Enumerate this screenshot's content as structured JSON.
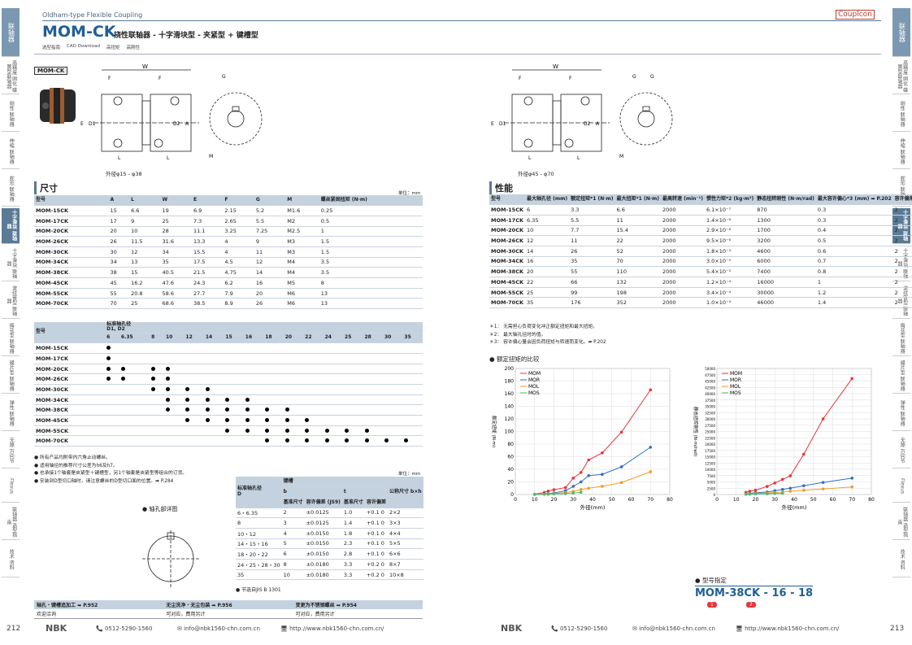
{
  "header": {
    "subtitle": "Oldham-type Flexible Coupling",
    "model": "MOM-CK",
    "desc": "挠性联轴器 - 十字滑块型 - 夹紧型 + 键槽型",
    "brand": "Couplcon",
    "links": [
      "选型指南",
      "CAD Download",
      "高扭矩",
      "高刚性"
    ]
  },
  "side_tabs_left": [
    "联轴器",
    "高精度 固化 碟簧型联轴器",
    "刚性 联轴器",
    "伸缩 联轴器",
    "蛇形 联轴器",
    "十字滑块 联轴器",
    "十字滑块 联轴器",
    "波纹管型 联轴器",
    "梅花型 联轴器",
    "膜片型 联轴器",
    "弹性 联轴器",
    "无隙 万向节",
    "Flexus",
    "联轴器 选型指南",
    "技术 资料"
  ],
  "side_tabs_right": [
    "联轴器",
    "高精度 固化 碟簧型联轴器",
    "刚性 联轴器",
    "伸缩 联轴器",
    "蛇形 联轴器",
    "十字滑块 联轴器",
    "十字滑块 联轴器",
    "波纹管型 联轴器",
    "梅花型 联轴器",
    "膜片型 联轴器",
    "弹性 联轴器",
    "无隙 万向节",
    "Flexus",
    "联轴器 选型指南",
    "技术 资料"
  ],
  "product_label": "MOM-CK",
  "diagram_left": {
    "caption": "外径φ15 - φ38",
    "labels": [
      "W",
      "F",
      "F",
      "G",
      "E",
      "D1",
      "D2",
      "A",
      "L",
      "L",
      "M"
    ]
  },
  "diagram_right": {
    "caption": "外径φ45 - φ70",
    "labels": [
      "W",
      "F",
      "F",
      "G",
      "G",
      "E",
      "D1",
      "D2",
      "A",
      "L",
      "L",
      "M"
    ]
  },
  "dimensions": {
    "title": "尺寸",
    "unit": "单位：mm",
    "headers": [
      "型号",
      "A",
      "L",
      "W",
      "E",
      "F",
      "G",
      "M",
      "螺丝紧固扭矩 (N·m)"
    ],
    "rows": [
      [
        "MOM-15CK",
        "15",
        "6.6",
        "19",
        "6.9",
        "2.15",
        "5.2",
        "M1.6",
        "0.25"
      ],
      [
        "MOM-17CK",
        "17",
        "9",
        "25",
        "7.3",
        "2.65",
        "5.5",
        "M2",
        "0.5"
      ],
      [
        "MOM-20CK",
        "20",
        "10",
        "28",
        "11.1",
        "3.25",
        "7.25",
        "M2.5",
        "1"
      ],
      [
        "MOM-26CK",
        "26",
        "11.5",
        "31.6",
        "13.3",
        "4",
        "9",
        "M3",
        "1.5"
      ],
      [
        "MOM-30CK",
        "30",
        "12",
        "34",
        "15.5",
        "4",
        "11",
        "M3",
        "1.5"
      ],
      [
        "MOM-34CK",
        "34",
        "13",
        "35",
        "17.5",
        "4.5",
        "12",
        "M4",
        "3.5"
      ],
      [
        "MOM-38CK",
        "38",
        "15",
        "40.5",
        "21.5",
        "4.75",
        "14",
        "M4",
        "3.5"
      ],
      [
        "MOM-45CK",
        "45",
        "16.2",
        "47.6",
        "24.3",
        "6.2",
        "16",
        "M5",
        "8"
      ],
      [
        "MOM-55CK",
        "55",
        "20.8",
        "58.6",
        "27.7",
        "7.9",
        "20",
        "M6",
        "13"
      ],
      [
        "MOM-70CK",
        "70",
        "25",
        "68.6",
        "38.5",
        "8.9",
        "26",
        "M6",
        "13"
      ]
    ]
  },
  "bore": {
    "head1": "型号",
    "head2": "标准轴孔径",
    "head3": "D1, D2",
    "sizes": [
      "6",
      "6.35",
      "8",
      "10",
      "12",
      "14",
      "15",
      "16",
      "18",
      "20",
      "22",
      "24",
      "25",
      "28",
      "30",
      "35"
    ],
    "rows": [
      {
        "model": "MOM-15CK",
        "d": [
          1,
          0,
          0,
          0,
          0,
          0,
          0,
          0,
          0,
          0,
          0,
          0,
          0,
          0,
          0,
          0
        ]
      },
      {
        "model": "MOM-17CK",
        "d": [
          1,
          0,
          0,
          0,
          0,
          0,
          0,
          0,
          0,
          0,
          0,
          0,
          0,
          0,
          0,
          0
        ]
      },
      {
        "model": "MOM-20CK",
        "d": [
          1,
          1,
          1,
          1,
          0,
          0,
          0,
          0,
          0,
          0,
          0,
          0,
          0,
          0,
          0,
          0
        ]
      },
      {
        "model": "MOM-26CK",
        "d": [
          1,
          1,
          1,
          1,
          0,
          0,
          0,
          0,
          0,
          0,
          0,
          0,
          0,
          0,
          0,
          0
        ]
      },
      {
        "model": "MOM-30CK",
        "d": [
          0,
          0,
          1,
          1,
          1,
          1,
          0,
          0,
          0,
          0,
          0,
          0,
          0,
          0,
          0,
          0
        ]
      },
      {
        "model": "MOM-34CK",
        "d": [
          0,
          0,
          0,
          1,
          1,
          1,
          1,
          1,
          0,
          0,
          0,
          0,
          0,
          0,
          0,
          0
        ]
      },
      {
        "model": "MOM-38CK",
        "d": [
          0,
          0,
          0,
          1,
          1,
          1,
          1,
          1,
          1,
          1,
          0,
          0,
          0,
          0,
          0,
          0
        ]
      },
      {
        "model": "MOM-45CK",
        "d": [
          0,
          0,
          0,
          0,
          1,
          1,
          1,
          1,
          1,
          1,
          1,
          0,
          0,
          0,
          0,
          0
        ]
      },
      {
        "model": "MOM-55CK",
        "d": [
          0,
          0,
          0,
          0,
          0,
          0,
          1,
          1,
          1,
          1,
          1,
          1,
          1,
          1,
          0,
          0
        ]
      },
      {
        "model": "MOM-70CK",
        "d": [
          0,
          0,
          0,
          0,
          0,
          0,
          0,
          0,
          1,
          1,
          1,
          1,
          1,
          1,
          1,
          1
        ]
      }
    ]
  },
  "notes_left": [
    "所有产品均附带内六角止动螺丝。",
    "适用轴径的推荐尺寸公差为h6及h7。",
    "也承接1个轴套是夹紧型＋键槽型，另1个轴套是夹紧型等组合的订货。",
    "安装到D型切口轴时，请注意螺丝的D型切口面的位置。➡ P.284"
  ],
  "keyway": {
    "unit": "单位：mm",
    "title": "轴孔部详图",
    "h_std": "标准轴孔径",
    "h_D": "D",
    "h_keyway": "键槽",
    "h_b": "b",
    "h_t": "t",
    "h_nominal": "基准尺寸",
    "h_tol": "容许偏差 (JS9)",
    "h_nominal2": "基准尺寸",
    "h_tol2": "容许偏差",
    "h_key": "公称尺寸 b×h",
    "rows": [
      [
        "6・6.35",
        "2",
        "±0.0125",
        "1.0",
        "+0.1 0",
        "2×2"
      ],
      [
        "8",
        "3",
        "±0.0125",
        "1.4",
        "+0.1 0",
        "3×3"
      ],
      [
        "10・12",
        "4",
        "±0.0150",
        "1.8",
        "+0.1 0",
        "4×4"
      ],
      [
        "14・15・16",
        "5",
        "±0.0150",
        "2.3",
        "+0.1 0",
        "5×5"
      ],
      [
        "18・20・22",
        "6",
        "±0.0150",
        "2.8",
        "+0.1 0",
        "6×6"
      ],
      [
        "24・25・28・30",
        "8",
        "±0.0180",
        "3.3",
        "+0.2 0",
        "8×7"
      ],
      [
        "35",
        "10",
        "±0.0180",
        "3.3",
        "+0.2 0",
        "10×8"
      ]
    ],
    "note": "节选自JIS B 1301"
  },
  "services": [
    {
      "label": "轴孔・键槽追加工 ➡ P.952",
      "sub": "欢迎洽询"
    },
    {
      "label": "无尘洗净・无尘包装 ➡ P.956",
      "sub": "可对应，费用另计"
    },
    {
      "label": "变更为不锈钢螺丝 ➡ P.954",
      "sub": "可对应，费用另计"
    }
  ],
  "perf": {
    "title": "性能",
    "headers": [
      "型号",
      "最大轴孔径 (mm)",
      "额定扭矩*1 (N·m)",
      "最大扭矩*1 (N·m)",
      "最高转速 (min⁻¹)",
      "惯性力矩*2 (kg·m²)",
      "静态扭转刚性 (N·m/rad)",
      "最大容许偏心*3 (mm) ➡ P.202",
      "容许偏角 (°)",
      "质量*2 (g)"
    ],
    "rows": [
      [
        "MOM-15CK",
        "6",
        "3.3",
        "6.6",
        "2000",
        "6.1×10⁻⁷",
        "870",
        "0.3",
        "2",
        "18"
      ],
      [
        "MOM-17CK",
        "6.35",
        "5.5",
        "11",
        "2000",
        "1.4×10⁻⁶",
        "1300",
        "0.3",
        "2",
        "33"
      ],
      [
        "MOM-20CK",
        "10",
        "7.7",
        "15.4",
        "2000",
        "2.9×10⁻⁶",
        "1700",
        "0.4",
        "2",
        "45"
      ],
      [
        "MOM-26CK",
        "12",
        "11",
        "22",
        "2000",
        "9.5×10⁻⁶",
        "3200",
        "0.5",
        "2",
        "90"
      ],
      [
        "MOM-30CK",
        "14",
        "26",
        "52",
        "2000",
        "1.8×10⁻⁵",
        "4600",
        "0.6",
        "2",
        "128"
      ],
      [
        "MOM-34CK",
        "16",
        "35",
        "70",
        "2000",
        "3.0×10⁻⁵",
        "6000",
        "0.7",
        "2",
        "170"
      ],
      [
        "MOM-38CK",
        "20",
        "55",
        "110",
        "2000",
        "5.4×10⁻⁵",
        "7400",
        "0.8",
        "2",
        "231"
      ],
      [
        "MOM-45CK",
        "22",
        "66",
        "132",
        "2000",
        "1.2×10⁻⁴",
        "16000",
        "1",
        "2",
        "383"
      ],
      [
        "MOM-55CK",
        "25",
        "99",
        "198",
        "2000",
        "3.4×10⁻⁴",
        "30000",
        "1.2",
        "2",
        "743"
      ],
      [
        "MOM-70CK",
        "35",
        "176",
        "352",
        "2000",
        "1.0×10⁻³",
        "46000",
        "1.4",
        "2",
        "1350"
      ]
    ],
    "notes": [
      "＊1：  无需担心负荷变化冲正额定扭矩和最大扭矩。",
      "＊2：  最大轴孔径时的值。",
      "＊3：  容许偏心量会因负荷扭矩与转速而变化。➡ P.202"
    ],
    "compare": "额定扭矩的比较"
  },
  "chart_data": [
    {
      "type": "line",
      "x_label": "外径(mm)",
      "y_label": "额定扭矩 (N·m)",
      "xlim": [
        0,
        80
      ],
      "ylim": [
        0,
        200
      ],
      "xticks": [
        0,
        10,
        20,
        30,
        40,
        50,
        60,
        70,
        80
      ],
      "yticks": [
        0,
        20,
        40,
        60,
        80,
        100,
        120,
        140,
        160,
        180,
        200
      ],
      "series": [
        {
          "name": "MOM",
          "color": "#e8343a",
          "x": [
            10,
            15,
            17,
            20,
            26,
            30,
            34,
            38,
            45,
            55,
            70
          ],
          "y": [
            0.5,
            3.3,
            5.5,
            7.7,
            11,
            26,
            35,
            55,
            66,
            99,
            166
          ]
        },
        {
          "name": "MOR",
          "color": "#2f6fc0",
          "x": [
            10,
            15,
            17,
            20,
            26,
            30,
            34,
            38,
            45,
            55,
            70
          ],
          "y": [
            0.3,
            1,
            1.5,
            2.5,
            6,
            13,
            20,
            30,
            32,
            44,
            75
          ]
        },
        {
          "name": "MOL",
          "color": "#f39a2a",
          "x": [
            10,
            15,
            17,
            20,
            26,
            30,
            34,
            38,
            45,
            55,
            70
          ],
          "y": [
            0.2,
            0.5,
            1,
            1.5,
            3,
            5,
            8,
            10,
            13,
            19,
            36
          ]
        },
        {
          "name": "MOS",
          "color": "#55b86a",
          "x": [
            10,
            15,
            17,
            20,
            26,
            30,
            34
          ],
          "y": [
            0.2,
            0.3,
            0.5,
            1,
            1.5,
            2.5,
            3.5
          ]
        }
      ]
    },
    {
      "type": "line",
      "x_label": "外径(mm)",
      "y_label": "静态扭转刚性 (N·m/rad)",
      "xlim": [
        0,
        80
      ],
      "ylim": [
        0,
        50000
      ],
      "xticks": [
        0,
        10,
        20,
        30,
        40,
        50,
        60,
        70,
        80
      ],
      "yticks": [
        0,
        2500,
        5000,
        7500,
        10000,
        12500,
        15000,
        17500,
        20000,
        22500,
        25000,
        27500,
        30000,
        32500,
        35000,
        37500,
        40000,
        42500,
        45000,
        47500,
        50000
      ],
      "series": [
        {
          "name": "MOM",
          "color": "#e8343a",
          "x": [
            15,
            17,
            20,
            26,
            30,
            34,
            38,
            45,
            55,
            70
          ],
          "y": [
            870,
            1300,
            1700,
            3200,
            4600,
            6000,
            7400,
            16000,
            30000,
            46000
          ]
        },
        {
          "name": "MOR",
          "color": "#2f6fc0",
          "x": [
            15,
            17,
            20,
            26,
            30,
            34,
            38,
            45,
            55,
            70
          ],
          "y": [
            300,
            500,
            700,
            1000,
            1500,
            2000,
            2500,
            3500,
            4800,
            6500
          ]
        },
        {
          "name": "MOL",
          "color": "#f39a2a",
          "x": [
            15,
            17,
            20,
            26,
            30,
            34,
            38,
            45,
            55,
            70
          ],
          "y": [
            200,
            300,
            400,
            600,
            800,
            1000,
            1300,
            1700,
            2200,
            3000
          ]
        },
        {
          "name": "MOS",
          "color": "#55b86a",
          "x": [
            15,
            17,
            20,
            26,
            30,
            34
          ],
          "y": [
            100,
            150,
            200,
            300,
            400,
            500
          ]
        }
      ]
    }
  ],
  "order": {
    "title": "型号指定",
    "example": "MOM-38CK - 16 - 18",
    "b1": "1",
    "b2": "2"
  },
  "footer_left": {
    "page": "212",
    "brand": "NBK",
    "tel": "0512-5290-1560",
    "mail": "info@nbk1560-chn.com.cn",
    "url": "http://www.nbk1560-chn.com.cn/"
  },
  "footer_right": {
    "page": "213",
    "brand": "NBK",
    "tel": "0512-5290-1560",
    "mail": "info@nbk1560-chn.com.cn",
    "url": "http://www.nbk1560-chn.com.cn/"
  }
}
